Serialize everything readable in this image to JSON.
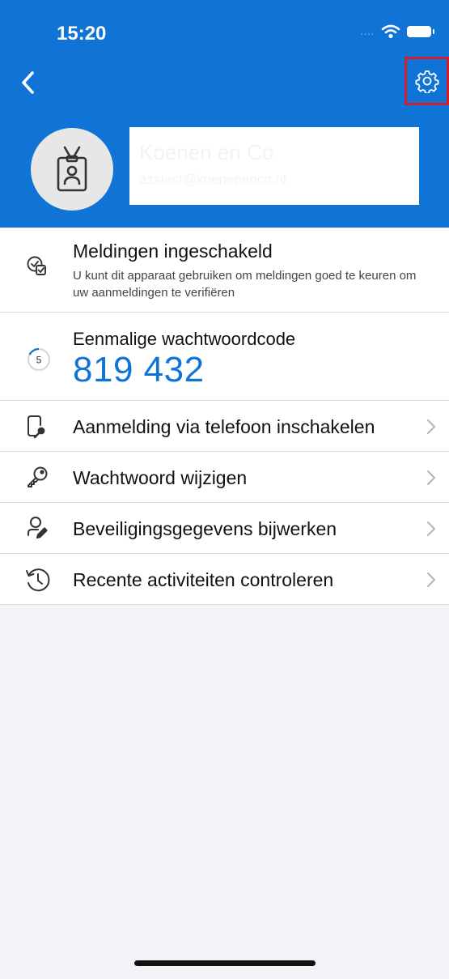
{
  "status_bar": {
    "time": "15:20",
    "signal": "....",
    "wifi_icon": "wifi-icon",
    "battery_icon": "battery-icon"
  },
  "header": {
    "background_color": "#0f74d6",
    "back_icon": "chevron-left-icon",
    "settings_icon": "gear-icon",
    "highlight_color": "#d61c2d",
    "account": {
      "name": "Koenen en Co",
      "email": "azstest@koenenenco.nl",
      "avatar_icon": "id-badge-icon"
    }
  },
  "notifications": {
    "icon": "check-badge-icon",
    "title": "Meldingen ingeschakeld",
    "description": "U kunt dit apparaat gebruiken om meldingen goed te keuren om uw aanmeldingen te verifiëren"
  },
  "otp": {
    "title": "Eenmalige wachtwoordcode",
    "countdown": "5",
    "code": "819 432",
    "accent_color": "#0f74d6"
  },
  "menu_items": [
    {
      "label": "Aanmelding via telefoon inschakelen",
      "icon": "phone-key-icon"
    },
    {
      "label": "Wachtwoord wijzigen",
      "icon": "key-icon"
    },
    {
      "label": "Beveiligingsgegevens bijwerken",
      "icon": "user-edit-icon"
    },
    {
      "label": "Recente activiteiten controleren",
      "icon": "history-icon"
    }
  ]
}
